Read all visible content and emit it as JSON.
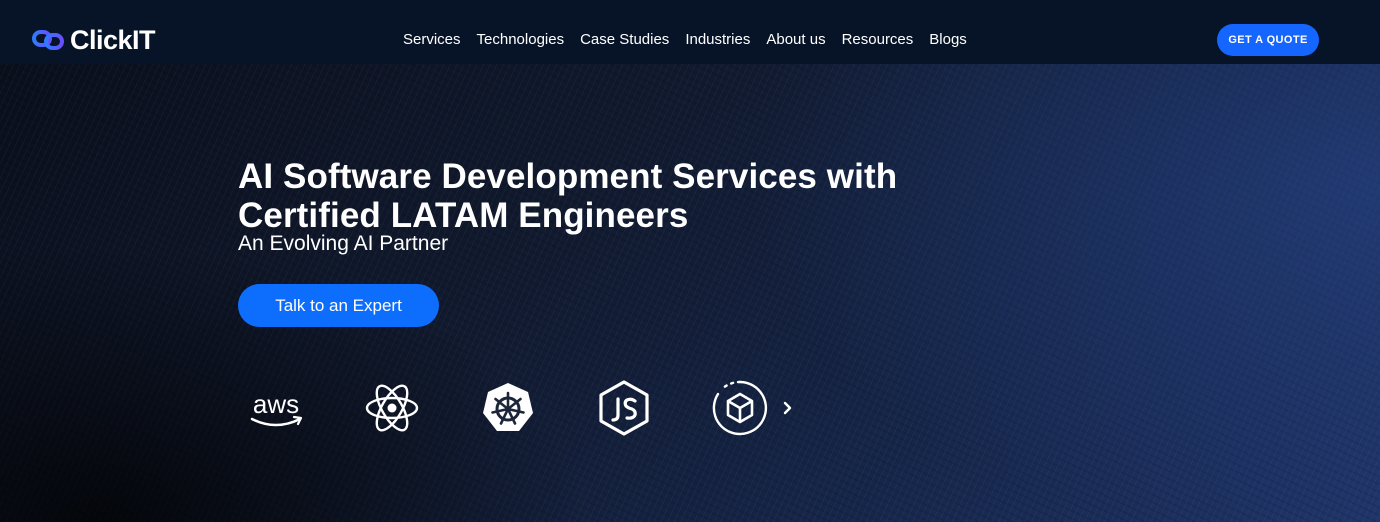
{
  "brand": {
    "name": "ClickIT",
    "accent": "#1565ff",
    "icon": "link-icon"
  },
  "nav": {
    "items": [
      {
        "label": "Services"
      },
      {
        "label": "Technologies"
      },
      {
        "label": "Case Studies"
      },
      {
        "label": "Industries"
      },
      {
        "label": "About us"
      },
      {
        "label": "Resources"
      },
      {
        "label": "Blogs"
      }
    ],
    "cta_label": "GET A QUOTE"
  },
  "hero": {
    "title": "AI Software Development Services with Certified LATAM Engineers",
    "subtitle": "An Evolving AI Partner",
    "cta_label": "Talk to an Expert",
    "tech_icons": [
      "aws-icon",
      "react-icon",
      "kubernetes-icon",
      "nodejs-icon",
      "cube-icon"
    ],
    "aws_text": "aws",
    "next_icon": "chevron-right-icon"
  }
}
